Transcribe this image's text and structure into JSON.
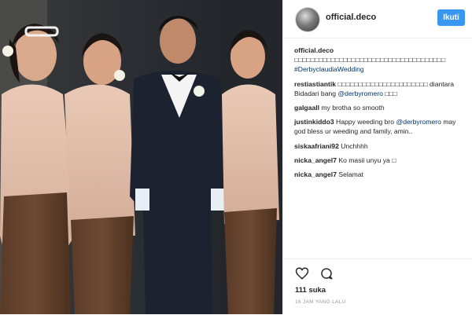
{
  "post": {
    "username": "official.deco",
    "follow_label": "Ikuti",
    "likes": "111 suka",
    "time": "16 JAM YANG LALU"
  },
  "comments": [
    {
      "user": "official.deco",
      "text": "□□□□□□□□□□□□□□□□□□□□□□□□□□□□□□□□□□□□□",
      "tag": "#DerbyclaudiaWedding"
    },
    {
      "user": "restiastiantik",
      "text": "□□□□□□□□□□□□□□□□□□□□□□ diantara Bidadari bang",
      "mention": "@derbyromero",
      "tail": "□□□"
    },
    {
      "user": "galgaall",
      "text": "my brotha so smooth"
    },
    {
      "user": "justinkiddo3",
      "text": "Happy weeding bro",
      "mention": "@derbyromero",
      "tail": "may god bless ur weeding and family, amin.."
    },
    {
      "user": "siskaafriani92",
      "text": "Unchhhh"
    },
    {
      "user": "nicka_angel7",
      "text": "Ko masii unyu ya □"
    },
    {
      "user": "nicka_angel7",
      "text": "Selamat"
    }
  ],
  "icons": {
    "like": "heart-icon",
    "comment": "comment-icon",
    "avatar": "avatar"
  },
  "colors": {
    "follow": "#3897f0",
    "mention": "#003569"
  }
}
